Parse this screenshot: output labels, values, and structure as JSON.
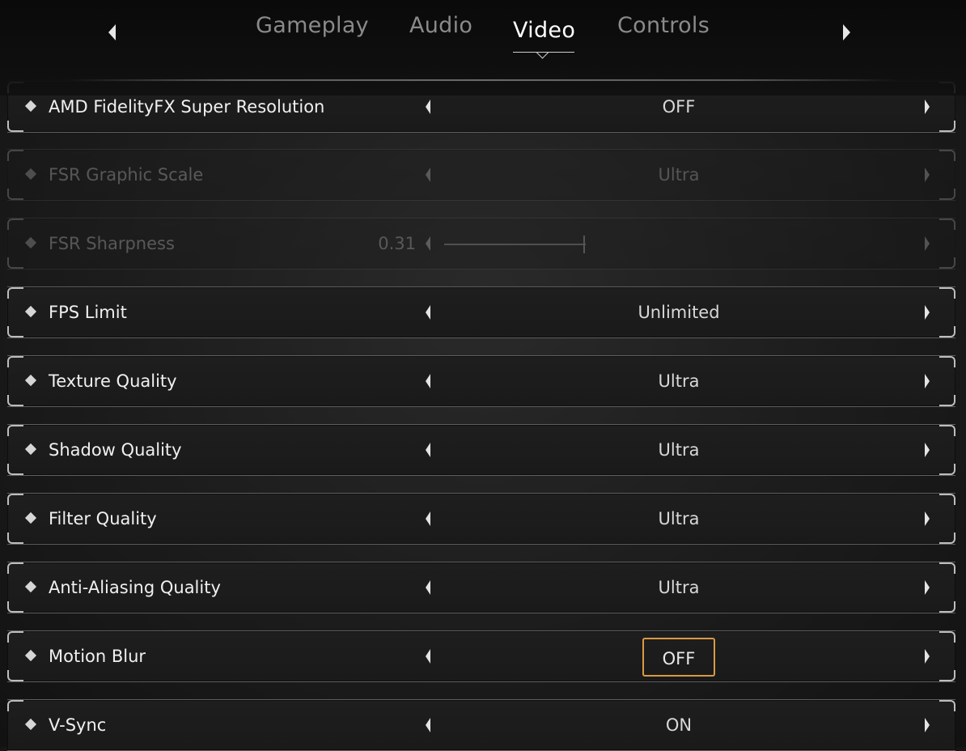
{
  "tabs": [
    {
      "label": "Gameplay",
      "active": false
    },
    {
      "label": "Audio",
      "active": false
    },
    {
      "label": "Video",
      "active": true
    },
    {
      "label": "Controls",
      "active": false
    }
  ],
  "settings": [
    {
      "label": "AMD FidelityFX Super Resolution",
      "value": "OFF",
      "enabled": true
    },
    {
      "label": "FSR Graphic Scale",
      "value": "Ultra",
      "enabled": false
    },
    {
      "label": "FSR Sharpness",
      "value": "0.31",
      "enabled": false,
      "type": "slider",
      "slider_fraction": 0.31
    },
    {
      "label": "FPS Limit",
      "value": "Unlimited",
      "enabled": true
    },
    {
      "label": "Texture Quality",
      "value": "Ultra",
      "enabled": true
    },
    {
      "label": "Shadow Quality",
      "value": "Ultra",
      "enabled": true
    },
    {
      "label": "Filter Quality",
      "value": "Ultra",
      "enabled": true
    },
    {
      "label": "Anti-Aliasing Quality",
      "value": "Ultra",
      "enabled": true
    },
    {
      "label": "Motion Blur",
      "value": "OFF",
      "enabled": true,
      "selected": true
    },
    {
      "label": "V-Sync",
      "value": "ON",
      "enabled": true
    }
  ],
  "colors": {
    "selection_border": "#d99a44",
    "active_tab": "#ffffff",
    "inactive_tab": "#8a8a8a"
  },
  "icons": {
    "nav_prev": "chevron-left-icon",
    "nav_next": "chevron-right-icon",
    "row_bullet": "diamond-icon"
  }
}
